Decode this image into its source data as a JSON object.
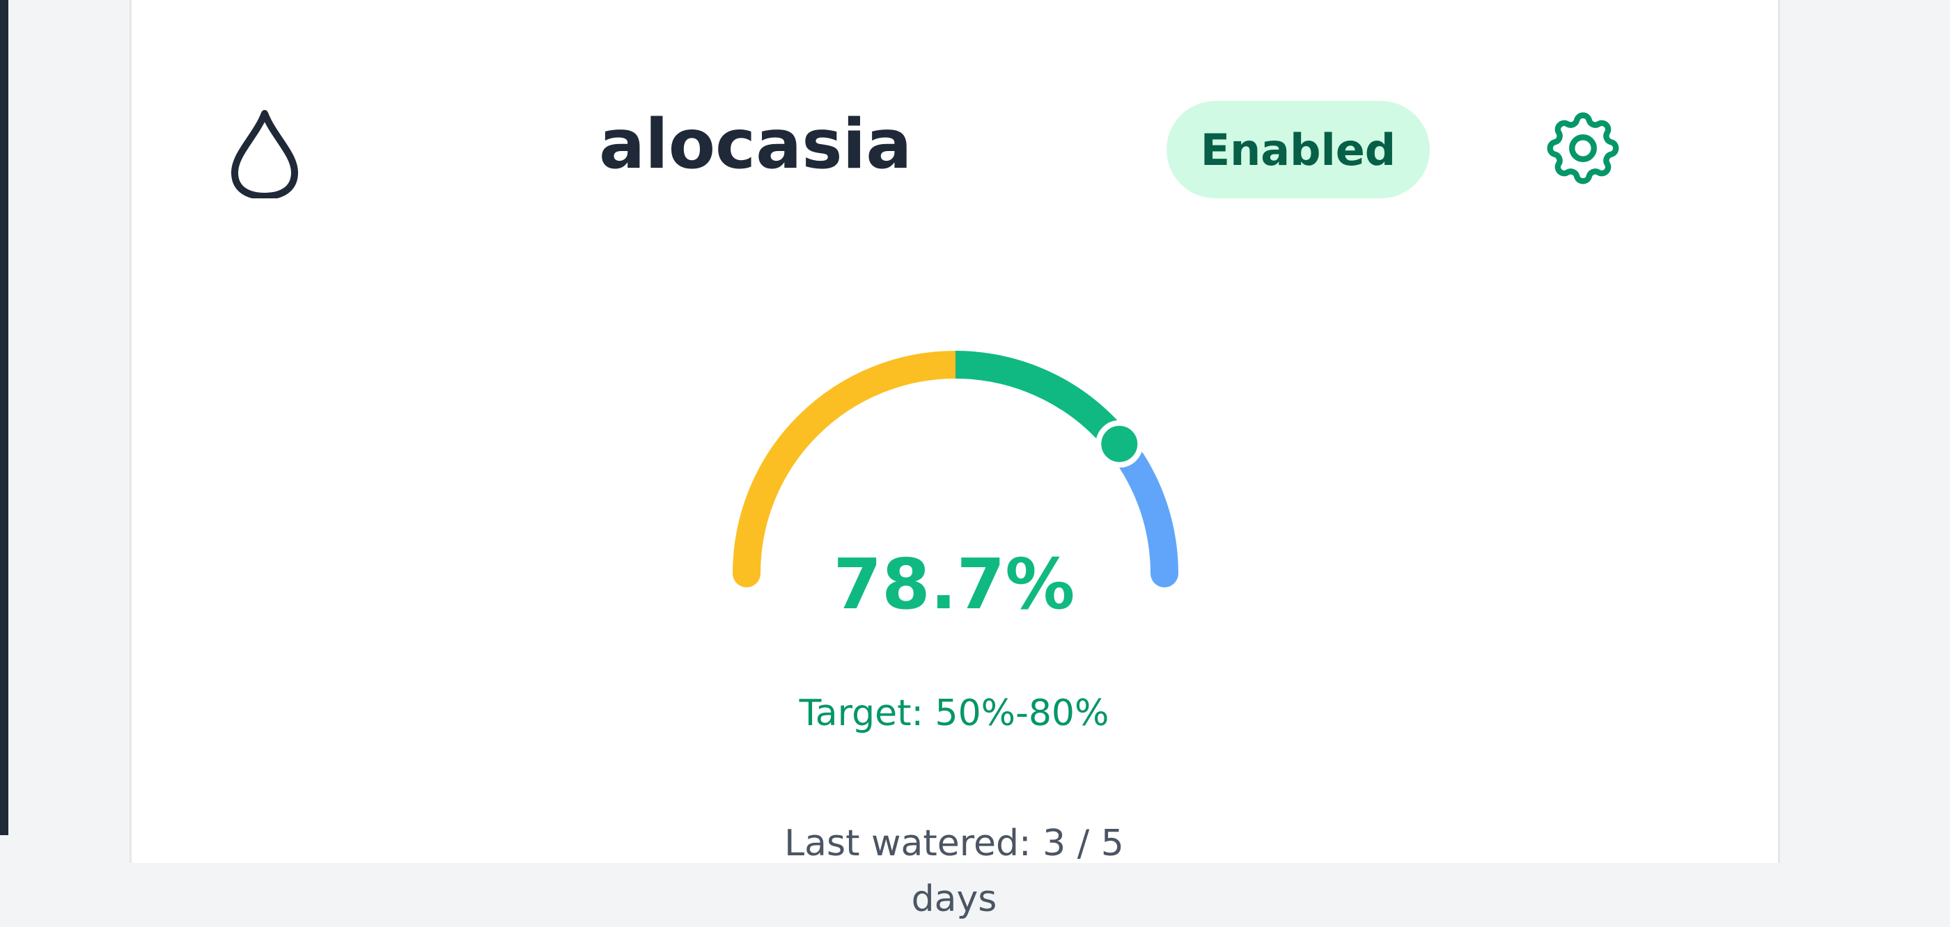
{
  "plant": {
    "name": "alocasia",
    "status_label": "Enabled",
    "moisture_display": "78.7%",
    "moisture_value": 78.7,
    "target_text": "Target: 50%-80%",
    "target_min": 50,
    "target_max": 80,
    "partial_text": "Last watered: 3 / 5 days"
  },
  "icons": {
    "moisture": "water-drop-icon",
    "settings": "gear-icon"
  },
  "colors": {
    "accent": "#10b981",
    "badge_bg": "#d1fae5",
    "badge_text": "#065f46",
    "gauge_low": "#fbbf24",
    "gauge_ok": "#10b981",
    "gauge_high": "#60a5fa",
    "text_dark": "#1f2937"
  }
}
